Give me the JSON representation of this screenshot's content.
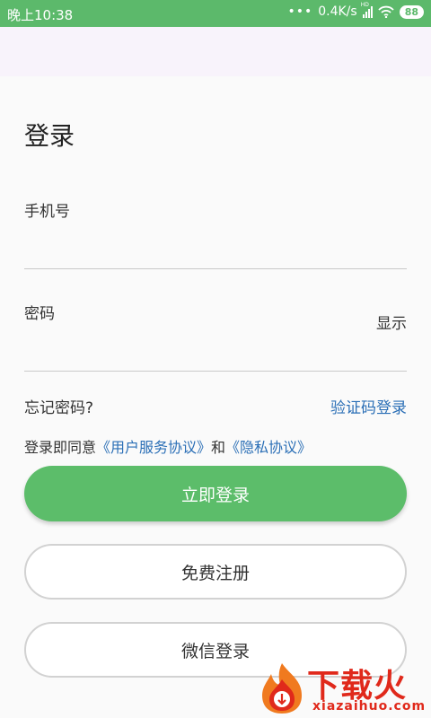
{
  "status_bar": {
    "time": "晚上10:38",
    "network_speed": "0.4K/s",
    "signal_badge": "HD",
    "battery": "88"
  },
  "login": {
    "title": "登录",
    "phone_label": "手机号",
    "password_label": "密码",
    "show_password": "显示",
    "forgot_password": "忘记密码?",
    "sms_login": "验证码登录",
    "agreement_prefix": "登录即同意",
    "user_agreement": "《用户服务协议》",
    "agreement_and": "和",
    "privacy_policy": "《隐私协议》",
    "login_button": "立即登录",
    "register_button": "免费注册",
    "wechat_button": "微信登录"
  },
  "watermark": {
    "title": "下载火",
    "subtitle": "xiazaihuo.com"
  },
  "colors": {
    "status_bar": "#5cb96b",
    "primary_button": "#5cbd6a",
    "link": "#2b6fb6",
    "watermark": "#e0291b"
  }
}
